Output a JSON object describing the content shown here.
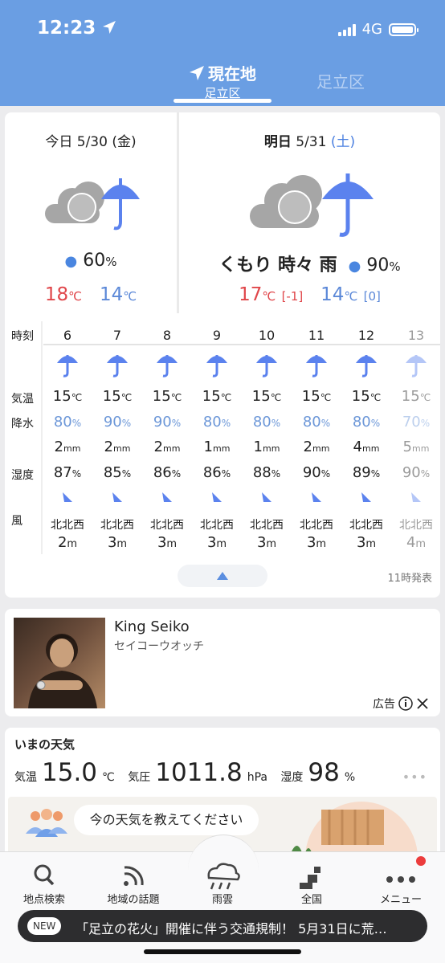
{
  "status": {
    "time": "12:23",
    "network": "4G"
  },
  "tabs": {
    "active_title": "現在地",
    "active_sub": "足立区",
    "other": "足立区"
  },
  "today": {
    "label": "今日",
    "date": "5/30",
    "weekday": "(金)",
    "rain_pct": "60",
    "pct_unit": "%",
    "high": "18",
    "low": "14",
    "temp_unit": "℃"
  },
  "tomorrow": {
    "label": "明日",
    "date": "5/31",
    "weekday": "(土)",
    "weather": "くもり 時々 雨",
    "rain_pct": "90",
    "pct_unit": "%",
    "high": "17",
    "high_diff": "[-1]",
    "low": "14",
    "low_diff": "[0]",
    "temp_unit": "℃"
  },
  "hourly": {
    "labels": {
      "hour": "時刻",
      "temp": "気温",
      "precip": "降水",
      "humidity": "湿度",
      "wind": "風"
    },
    "hours": [
      {
        "hour": "6",
        "temp": "15",
        "pct": "80",
        "mm": "2",
        "hum": "87",
        "dir": "北北西",
        "spd": "2"
      },
      {
        "hour": "7",
        "temp": "15",
        "pct": "90",
        "mm": "2",
        "hum": "85",
        "dir": "北北西",
        "spd": "3"
      },
      {
        "hour": "8",
        "temp": "15",
        "pct": "90",
        "mm": "2",
        "hum": "86",
        "dir": "北北西",
        "spd": "3"
      },
      {
        "hour": "9",
        "temp": "15",
        "pct": "80",
        "mm": "1",
        "hum": "86",
        "dir": "北北西",
        "spd": "3"
      },
      {
        "hour": "10",
        "temp": "15",
        "pct": "80",
        "mm": "1",
        "hum": "88",
        "dir": "北北西",
        "spd": "3"
      },
      {
        "hour": "11",
        "temp": "15",
        "pct": "80",
        "mm": "2",
        "hum": "90",
        "dir": "北北西",
        "spd": "3"
      },
      {
        "hour": "12",
        "temp": "15",
        "pct": "80",
        "mm": "4",
        "hum": "89",
        "dir": "北北西",
        "spd": "3"
      },
      {
        "hour": "13",
        "temp": "15",
        "pct": "70",
        "mm": "5",
        "hum": "90",
        "dir": "北北西",
        "spd": "4"
      }
    ],
    "units": {
      "temp": "℃",
      "pct": "%",
      "mm": "mm",
      "hum": "%",
      "spd": "m"
    },
    "issued": "11時発表"
  },
  "ad": {
    "title": "King Seiko",
    "subtitle": "セイコーウオッチ",
    "label": "広告"
  },
  "now": {
    "title": "いまの天気",
    "temp_label": "気温",
    "temp_value": "15.0",
    "temp_unit": "℃",
    "pressure_label": "気圧",
    "pressure_value": "1011.8",
    "pressure_unit": "hPa",
    "humidity_label": "湿度",
    "humidity_value": "98",
    "humidity_unit": "%",
    "prompt": "今の天気を教えてください"
  },
  "tabbar": [
    {
      "label": "地点検索",
      "icon": "search-icon"
    },
    {
      "label": "地域の話題",
      "icon": "feed-icon"
    },
    {
      "label": "雨雲",
      "icon": "rain-cloud-icon"
    },
    {
      "label": "全国",
      "icon": "map-icon"
    },
    {
      "label": "メニュー",
      "icon": "menu-icon"
    }
  ],
  "ticker": {
    "badge": "NEW",
    "text": "「足立の花火」開催に伴う交通規制！ 5月31日に荒…"
  },
  "colors": {
    "header": "#6a9ee3",
    "high_temp": "#e0464a",
    "low_temp": "#5b88d8",
    "umbrella": "#5b82ee",
    "cloud": "#a6a6a6"
  }
}
